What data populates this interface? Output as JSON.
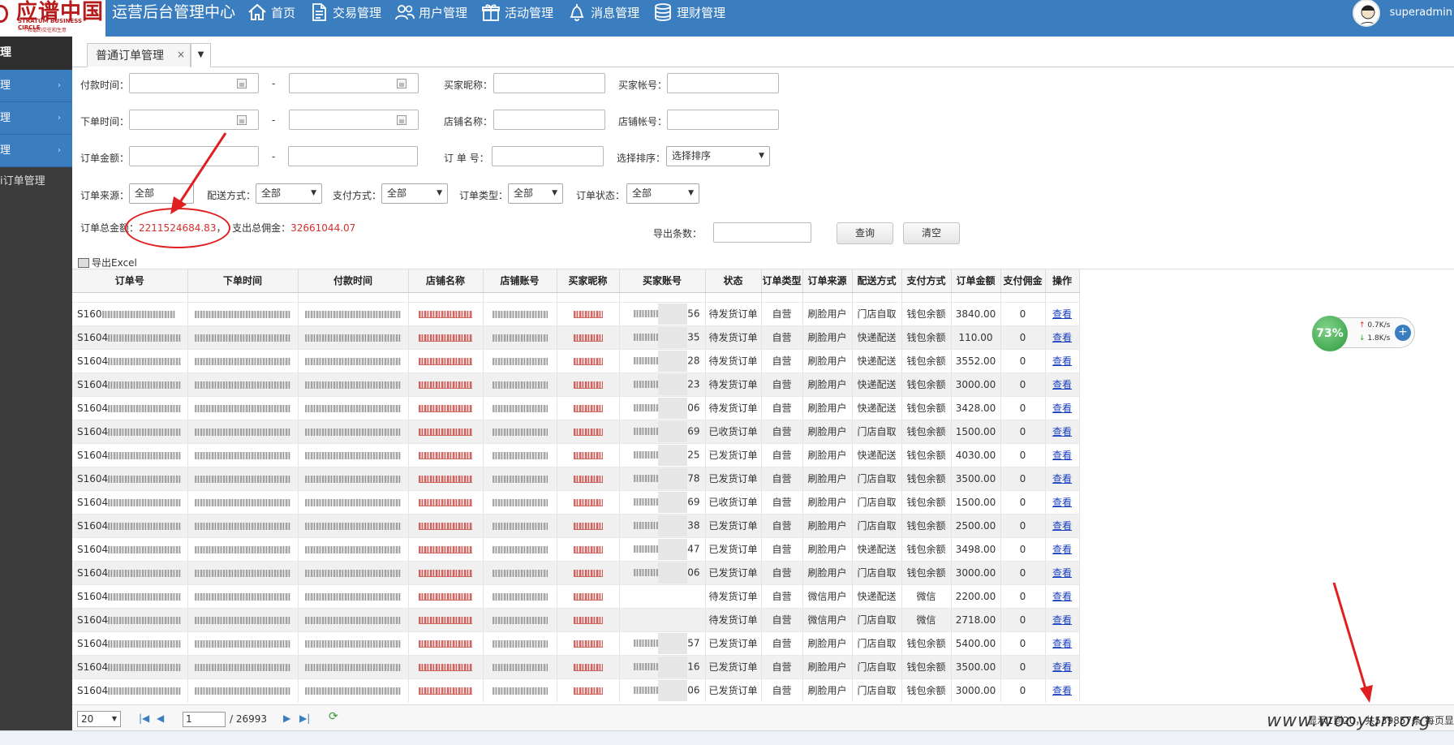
{
  "header": {
    "logo_cn": "应谱中国",
    "logo_en": "STRATUM BUSINESS CIRCLE",
    "logo_sub": "一个和谐的交往和生意",
    "app_title": "运营后台管理中心",
    "nav": [
      {
        "label": "首页",
        "icon": "home-icon"
      },
      {
        "label": "交易管理",
        "icon": "document-icon"
      },
      {
        "label": "用户管理",
        "icon": "users-icon"
      },
      {
        "label": "活动管理",
        "icon": "gift-icon"
      },
      {
        "label": "消息管理",
        "icon": "bell-icon"
      },
      {
        "label": "理财管理",
        "icon": "database-icon"
      }
    ],
    "user_name": "superadmin"
  },
  "sidebar": {
    "head": "理",
    "items": [
      {
        "label": "理",
        "active": false
      },
      {
        "label": "理",
        "active": false
      },
      {
        "label": "理",
        "active": true
      }
    ],
    "sub_item": "i订单管理"
  },
  "tabs": [
    {
      "label": "普通订单管理",
      "close": "×"
    }
  ],
  "filters": {
    "pay_time_label": "付款时间：",
    "order_time_label": "下单时间：",
    "amount_label": "订单金额：",
    "dash": "-",
    "buyer_nick_label": "买家昵称：",
    "buyer_account_label": "买家帐号：",
    "shop_name_label": "店铺名称：",
    "shop_account_label": "店铺帐号：",
    "order_no_label": "订 单 号：",
    "sort_label": "选择排序：",
    "sort_value": "选择排序",
    "source_label": "订单来源：",
    "source_value": "全部",
    "delivery_label": "配送方式：",
    "delivery_value": "全部",
    "payment_label": "支付方式：",
    "payment_value": "全部",
    "type_label": "订单类型：",
    "type_value": "全部",
    "status_label": "订单状态：",
    "status_value": "全部",
    "export_count_label": "导出条数："
  },
  "summary": {
    "total_label": "订单总金额：",
    "total_value": "2211524684.83",
    "sep": "，",
    "commission_label": "支出总佣金：",
    "commission_value": "32661044.07"
  },
  "buttons": {
    "query": "查询",
    "clear": "清空",
    "export_excel": "导出Excel"
  },
  "table": {
    "columns": [
      "订单号",
      "下单时间",
      "付款时间",
      "店铺名称",
      "店铺账号",
      "买家昵称",
      "买家账号",
      "状态",
      "订单类型",
      "订单来源",
      "配送方式",
      "支付方式",
      "订单金额",
      "支付佣金",
      "操作"
    ],
    "rows": [
      {
        "order_prefix": "S160",
        "buyer_suffix": "56",
        "status": "待发货订单",
        "type": "自营",
        "source": "刷脸用户",
        "delivery": "门店自取",
        "payment": "钱包余额",
        "amount": "3840.00",
        "commission": "0",
        "action": "查看"
      },
      {
        "order_prefix": "S1604",
        "buyer_suffix": "35",
        "status": "待发货订单",
        "type": "自营",
        "source": "刷脸用户",
        "delivery": "快递配送",
        "payment": "钱包余额",
        "amount": "110.00",
        "commission": "0",
        "action": "查看"
      },
      {
        "order_prefix": "S1604",
        "buyer_suffix": "28",
        "status": "待发货订单",
        "type": "自营",
        "source": "刷脸用户",
        "delivery": "快递配送",
        "payment": "钱包余额",
        "amount": "3552.00",
        "commission": "0",
        "action": "查看"
      },
      {
        "order_prefix": "S1604",
        "buyer_suffix": "23",
        "status": "待发货订单",
        "type": "自营",
        "source": "刷脸用户",
        "delivery": "快递配送",
        "payment": "钱包余额",
        "amount": "3000.00",
        "commission": "0",
        "action": "查看"
      },
      {
        "order_prefix": "S1604",
        "buyer_suffix": "06",
        "status": "待发货订单",
        "type": "自营",
        "source": "刷脸用户",
        "delivery": "快递配送",
        "payment": "钱包余额",
        "amount": "3428.00",
        "commission": "0",
        "action": "查看"
      },
      {
        "order_prefix": "S1604",
        "buyer_suffix": "69",
        "status": "已收货订单",
        "type": "自营",
        "source": "刷脸用户",
        "delivery": "门店自取",
        "payment": "钱包余额",
        "amount": "1500.00",
        "commission": "0",
        "action": "查看"
      },
      {
        "order_prefix": "S1604",
        "buyer_suffix": "25",
        "status": "已发货订单",
        "type": "自营",
        "source": "刷脸用户",
        "delivery": "快递配送",
        "payment": "钱包余额",
        "amount": "4030.00",
        "commission": "0",
        "action": "查看"
      },
      {
        "order_prefix": "S1604",
        "buyer_suffix": "78",
        "status": "已发货订单",
        "type": "自营",
        "source": "刷脸用户",
        "delivery": "门店自取",
        "payment": "钱包余额",
        "amount": "3500.00",
        "commission": "0",
        "action": "查看"
      },
      {
        "order_prefix": "S1604",
        "buyer_suffix": "69",
        "status": "已收货订单",
        "type": "自营",
        "source": "刷脸用户",
        "delivery": "门店自取",
        "payment": "钱包余额",
        "amount": "1500.00",
        "commission": "0",
        "action": "查看"
      },
      {
        "order_prefix": "S1604",
        "buyer_suffix": "38",
        "status": "已发货订单",
        "type": "自营",
        "source": "刷脸用户",
        "delivery": "门店自取",
        "payment": "钱包余额",
        "amount": "2500.00",
        "commission": "0",
        "action": "查看"
      },
      {
        "order_prefix": "S1604",
        "buyer_suffix": "47",
        "status": "已发货订单",
        "type": "自营",
        "source": "刷脸用户",
        "delivery": "快递配送",
        "payment": "钱包余额",
        "amount": "3498.00",
        "commission": "0",
        "action": "查看"
      },
      {
        "order_prefix": "S1604",
        "buyer_suffix": "06",
        "status": "已发货订单",
        "type": "自营",
        "source": "刷脸用户",
        "delivery": "门店自取",
        "payment": "钱包余额",
        "amount": "3000.00",
        "commission": "0",
        "action": "查看"
      },
      {
        "order_prefix": "S1604",
        "buyer_suffix": "",
        "status": "待发货订单",
        "type": "自营",
        "source": "微信用户",
        "delivery": "快递配送",
        "payment": "微信",
        "amount": "2200.00",
        "commission": "0",
        "action": "查看"
      },
      {
        "order_prefix": "S1604",
        "buyer_suffix": "",
        "status": "待发货订单",
        "type": "自营",
        "source": "微信用户",
        "delivery": "门店自取",
        "payment": "微信",
        "amount": "2718.00",
        "commission": "0",
        "action": "查看"
      },
      {
        "order_prefix": "S1604",
        "buyer_suffix": "57",
        "status": "已发货订单",
        "type": "自营",
        "source": "刷脸用户",
        "delivery": "门店自取",
        "payment": "钱包余额",
        "amount": "5400.00",
        "commission": "0",
        "action": "查看"
      },
      {
        "order_prefix": "S1604",
        "buyer_suffix": "16",
        "status": "已发货订单",
        "type": "自营",
        "source": "刷脸用户",
        "delivery": "门店自取",
        "payment": "钱包余额",
        "amount": "3500.00",
        "commission": "0",
        "action": "查看"
      },
      {
        "order_prefix": "S1604",
        "buyer_suffix": "06",
        "status": "已发货订单",
        "type": "自营",
        "source": "刷脸用户",
        "delivery": "门店自取",
        "payment": "钱包余额",
        "amount": "3000.00",
        "commission": "0",
        "action": "查看"
      }
    ]
  },
  "pager": {
    "page_size": "20",
    "current_page": "1",
    "total_pages": "/ 26993",
    "info": "显示1到20，共539857条 每页显"
  },
  "widget": {
    "percent": "73%",
    "up_speed": "0.7K/s",
    "down_speed": "1.8K/s",
    "plus": "+"
  },
  "watermark": "www.wooyun.org",
  "colors": {
    "topbar": "#3b7ec0",
    "sidebar": "#3c3c3c",
    "highlight_red": "#d32f2f",
    "link": "#1a3fc1",
    "annotation": "#e02020"
  }
}
